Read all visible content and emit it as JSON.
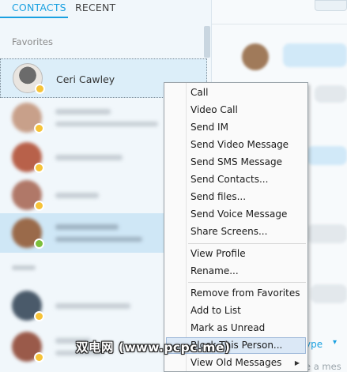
{
  "tabs": {
    "contacts": "CONTACTS",
    "recent": "RECENT"
  },
  "contacts": {
    "favorites_header": "Favorites",
    "selected_contact": {
      "name": "Ceri Cawley",
      "status": "away"
    },
    "status_colors": {
      "away": "#f6c338",
      "online": "#7cbf3c"
    }
  },
  "menu": {
    "items": [
      "Call",
      "Video Call",
      "Send IM",
      "Send Video Message",
      "Send SMS Message",
      "Send Contacts...",
      "Send files...",
      "Send Voice Message",
      "Share Screens...",
      "View Profile",
      "Rename...",
      "Remove from Favorites",
      "Add to List",
      "Mark as Unread",
      "Block This Person...",
      "View Old Messages"
    ],
    "highlighted": "Block This Person...",
    "submenu_item": "View Old Messages"
  },
  "conversation": {
    "type_label": "ype",
    "message_hint": "e a mes"
  },
  "watermark": "双电网 (www.pcpc.me)",
  "colors": {
    "accent": "#1aa1e1",
    "menu_highlight": "#dbe8f6"
  },
  "icons": [
    "away-status-icon",
    "online-status-icon",
    "submenu-arrow-icon",
    "chevron-down-icon"
  ]
}
